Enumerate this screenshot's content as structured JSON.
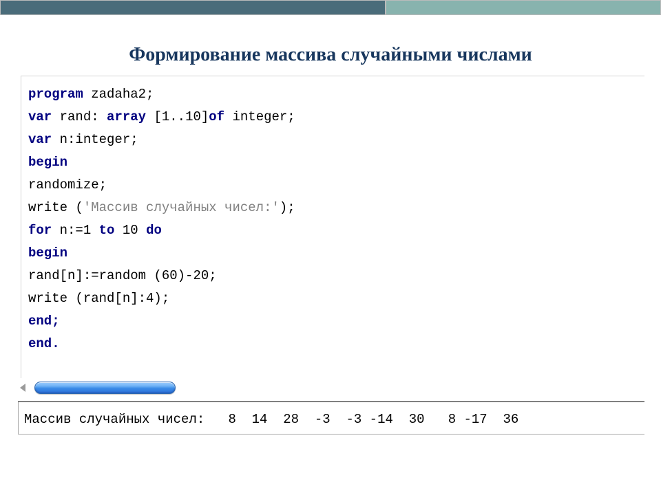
{
  "heading": "Формирование массива случайными числами",
  "code": {
    "l1a": "program",
    "l1b": " zadaha2;",
    "l2a": "var",
    "l2b": " rand: ",
    "l2c": "array",
    "l2d": " [1..10]",
    "l2e": "of",
    "l2f": " integer;",
    "l3a": "var",
    "l3b": " n:integer;",
    "l4": "begin",
    "l5": "randomize;",
    "l6a": "write (",
    "l6b": "'Массив случайных чисел:'",
    "l6c": ");",
    "l7a": "for",
    "l7b": " n:=1 ",
    "l7c": "to",
    "l7d": " 10 ",
    "l7e": "do",
    "l8": "begin",
    "l9": "rand[n]:=random (60)-20;",
    "l10": "write (rand[n]:4);",
    "l11": "end;",
    "l12": "end."
  },
  "output": {
    "label": "Массив случайных чисел:",
    "values": [
      8,
      14,
      28,
      -3,
      -3,
      -14,
      30,
      8,
      -17,
      36
    ],
    "line": "Массив случайных чисел:   8  14  28  -3  -3 -14  30   8 -17  36"
  }
}
